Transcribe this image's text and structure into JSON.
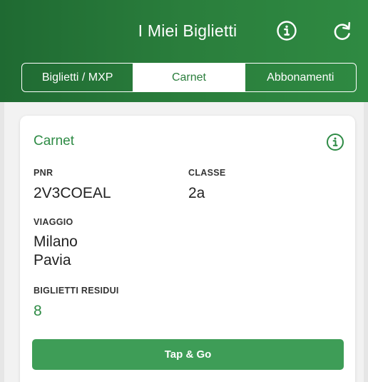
{
  "header": {
    "title": "I Miei Biglietti",
    "info_icon": "info-circle-icon",
    "refresh_icon": "refresh-icon",
    "background": "#2a7e3c"
  },
  "tabs": [
    {
      "label": "Biglietti / MXP",
      "active": false
    },
    {
      "label": "Carnet",
      "active": true
    },
    {
      "label": "Abbonamenti",
      "active": false
    }
  ],
  "card": {
    "title": "Carnet",
    "info_icon": "info-circle-icon",
    "pnr_label": "PNR",
    "pnr_value": "2V3COEAL",
    "classe_label": "CLASSE",
    "classe_value": "2a",
    "viaggio_label": "VIAGGIO",
    "viaggio_from": "Milano",
    "viaggio_to": "Pavia",
    "residui_label": "BIGLIETTI RESIDUI",
    "residui_value": "8",
    "button_label": "Tap & Go",
    "accent": "#2e8b45"
  }
}
